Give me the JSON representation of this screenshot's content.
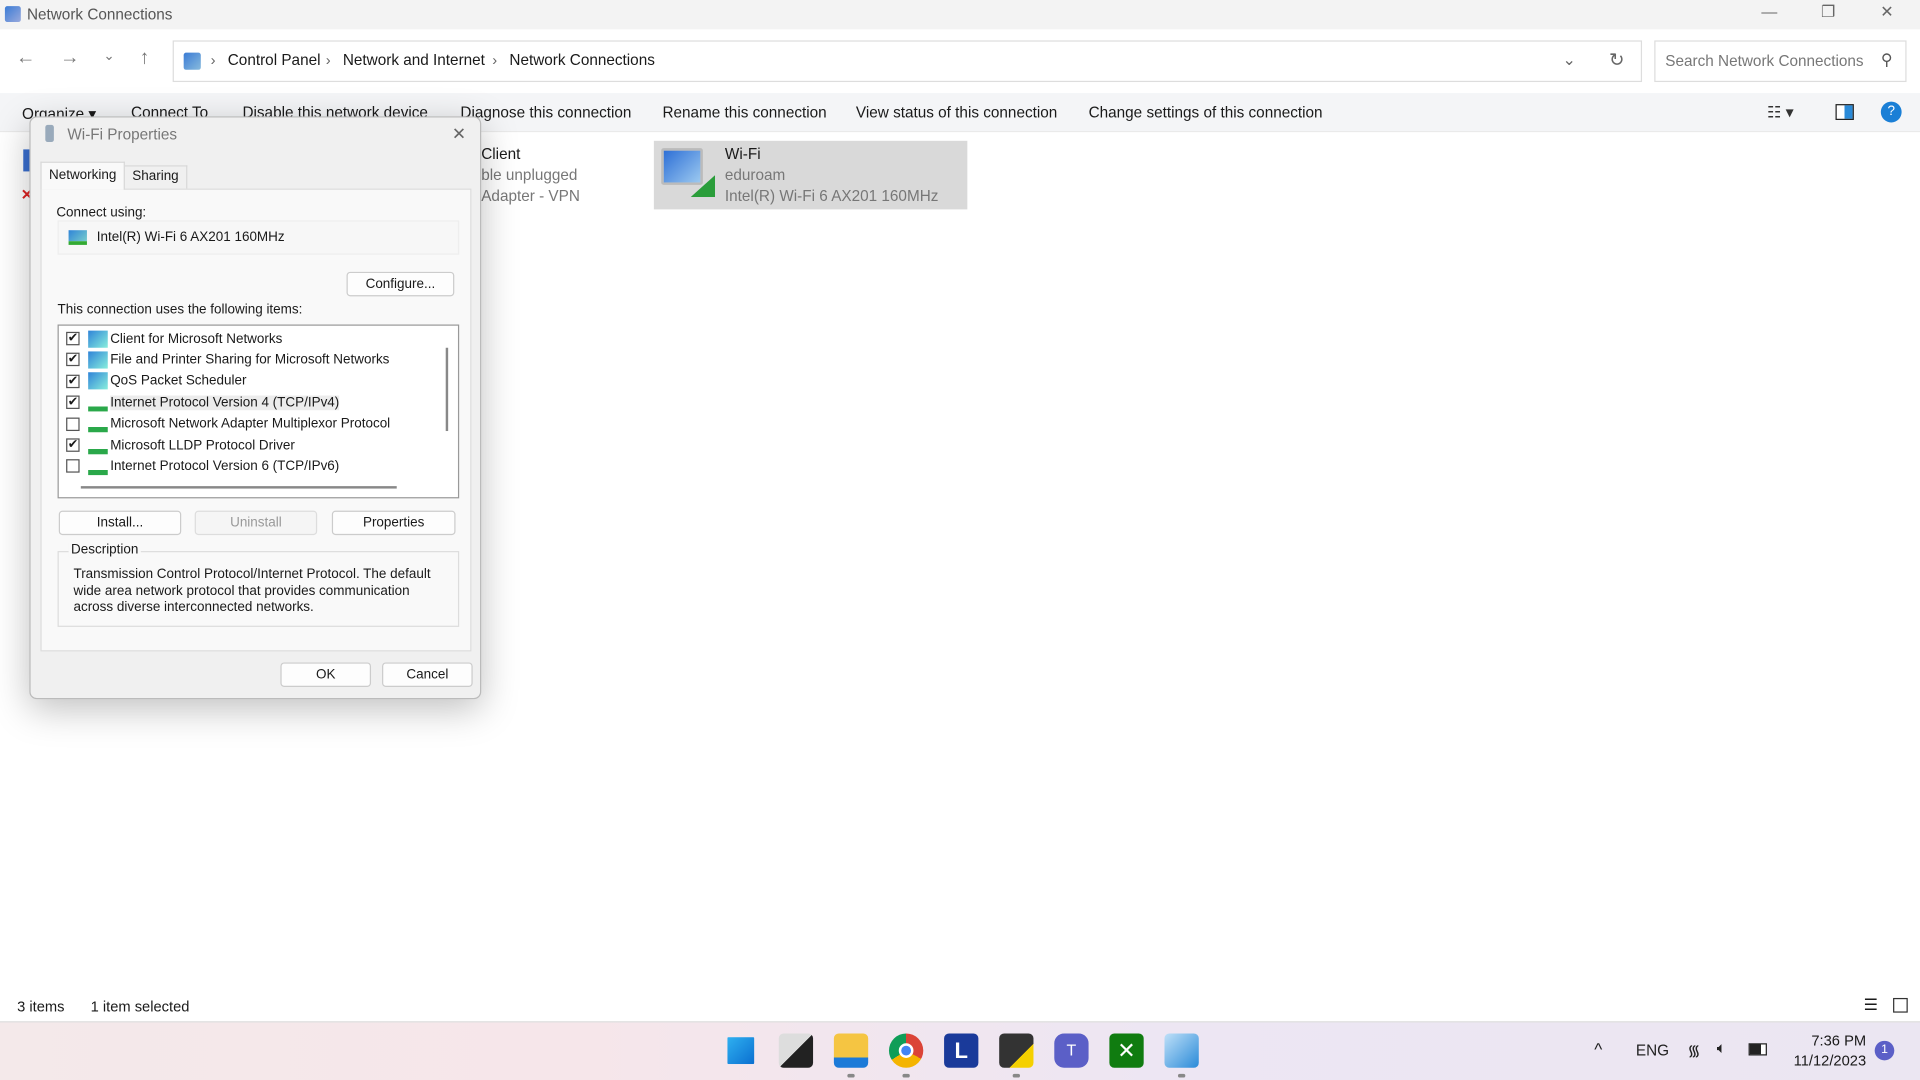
{
  "window": {
    "title": "Network Connections"
  },
  "breadcrumb": [
    "Control Panel",
    "Network and Internet",
    "Network Connections"
  ],
  "search": {
    "placeholder": "Search Network Connections"
  },
  "commands": [
    "Organize ▾",
    "Connect To",
    "Disable this network device",
    "Diagnose this connection",
    "Rename this connection",
    "View status of this connection",
    "Change settings of this connection"
  ],
  "connections": [
    {
      "name": "Client",
      "status": "ble unplugged",
      "device": "Adapter - VPN"
    },
    {
      "name": "Wi-Fi",
      "status": "eduroam",
      "device": "Intel(R) Wi-Fi 6 AX201 160MHz"
    }
  ],
  "statusbar": {
    "count": "3 items",
    "selected": "1 item selected"
  },
  "dialog": {
    "title": "Wi-Fi Properties",
    "tabs": [
      "Networking",
      "Sharing"
    ],
    "connect_using_label": "Connect using:",
    "adapter": "Intel(R) Wi-Fi 6 AX201 160MHz",
    "configure": "Configure...",
    "items_label": "This connection uses the following items:",
    "items": [
      {
        "label": "Client for Microsoft Networks",
        "checked": true
      },
      {
        "label": "File and Printer Sharing for Microsoft Networks",
        "checked": true
      },
      {
        "label": "QoS Packet Scheduler",
        "checked": true
      },
      {
        "label": "Internet Protocol Version 4 (TCP/IPv4)",
        "checked": true
      },
      {
        "label": "Microsoft Network Adapter Multiplexor Protocol",
        "checked": false
      },
      {
        "label": "Microsoft LLDP Protocol Driver",
        "checked": true
      },
      {
        "label": "Internet Protocol Version 6 (TCP/IPv6)",
        "checked": false
      }
    ],
    "install": "Install...",
    "uninstall": "Uninstall",
    "properties": "Properties",
    "description_title": "Description",
    "description": "Transmission Control Protocol/Internet Protocol. The default wide area network protocol that provides communication across diverse interconnected networks.",
    "ok": "OK",
    "cancel": "Cancel"
  },
  "tray": {
    "lang": "ENG",
    "time": "7:36 PM",
    "date": "11/12/2023",
    "notifications": "1"
  },
  "colors": {
    "accent": "#0067c0",
    "selected": "#d9d9d9",
    "badge": "#5b5fc7"
  }
}
